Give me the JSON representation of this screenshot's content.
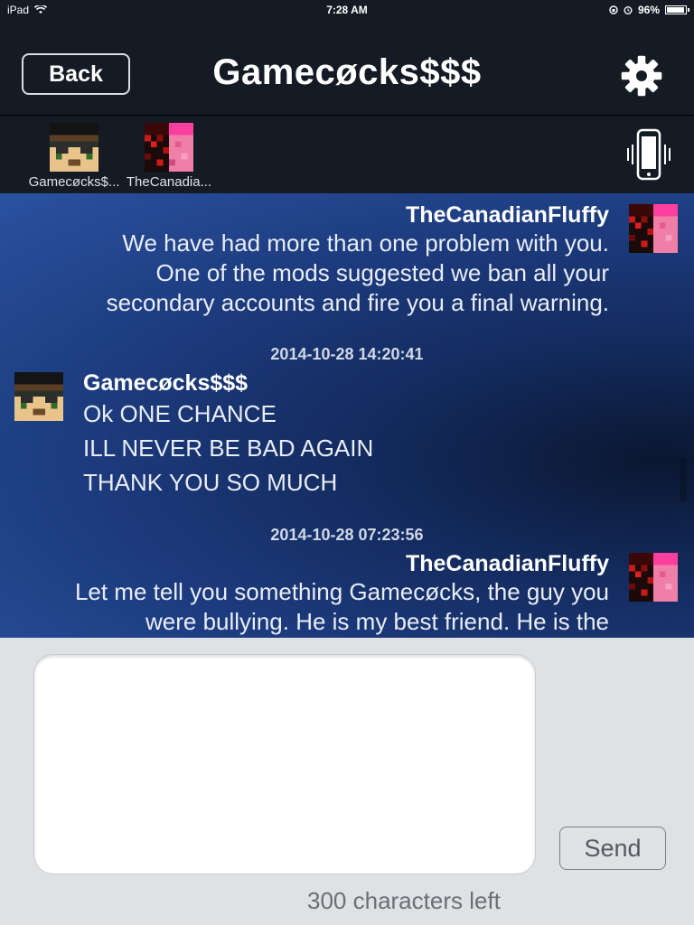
{
  "status": {
    "device": "iPad",
    "time": "7:28 AM",
    "battery": "96%",
    "battery_level": 0.96
  },
  "header": {
    "back_label": "Back",
    "title": "Gamecøcks$$$",
    "settings_icon": "gear-icon"
  },
  "participants": [
    {
      "name": "Gamecøcks$..."
    },
    {
      "name": "TheCanadia..."
    }
  ],
  "messages": [
    {
      "author": "TheCanadianFluffy",
      "lines": [
        "We have had more than one problem with you.",
        "One of the mods suggested we ban all your",
        "secondary accounts and fire you a final warning."
      ]
    },
    {
      "timestamp": "2014-10-28 14:20:41"
    },
    {
      "author": "Gamecøcks$$$",
      "lines": [
        "Ok ONE CHANCE",
        "ILL NEVER BE BAD AGAIN",
        "THANK YOU SO MUCH"
      ]
    },
    {
      "timestamp": "2014-10-28 07:23:56"
    },
    {
      "author": "TheCanadianFluffy",
      "lines": [
        "Let me tell you something Gamecøcks, the guy you",
        "were bullying. He is my best friend. He is the"
      ]
    }
  ],
  "composer": {
    "send_label": "Send",
    "counter": "300 characters left",
    "input_value": ""
  }
}
